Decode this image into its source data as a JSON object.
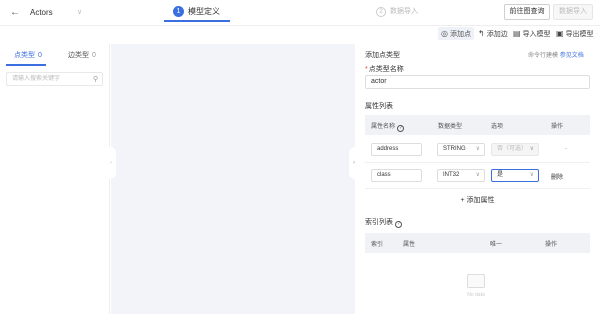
{
  "header": {
    "back_icon": "arrow-left-icon",
    "title": "Actors",
    "steps": [
      {
        "num": "1",
        "label": "模型定义"
      },
      {
        "num": "2",
        "label": "数据导入"
      }
    ],
    "query_button": "前往图查询",
    "import_button": "数据导入"
  },
  "toolbar": {
    "add_node": "添加点",
    "add_edge": "添加边",
    "import_model": "导入模型",
    "export_model": "导出模型"
  },
  "left": {
    "tabs": [
      {
        "label": "点类型",
        "count": "0"
      },
      {
        "label": "边类型",
        "count": "0"
      }
    ],
    "search_placeholder": "请输入搜索关键字"
  },
  "right": {
    "title": "添加点类型",
    "cli_text": "命令行建模",
    "cli_link": "参见文档",
    "name_label": "点类型名称",
    "name_value": "actor",
    "props_label": "属性列表",
    "prop_headers": {
      "name": "属性名称",
      "type": "数据类型",
      "option": "选项",
      "action": "操作"
    },
    "props": [
      {
        "name": "address",
        "type": "STRING",
        "option": "否（可选）",
        "action": "-"
      },
      {
        "name": "class",
        "type": "INT32",
        "option": "是",
        "action": "删除"
      }
    ],
    "add_prop": "添加属性",
    "index_label": "索引列表",
    "index_headers": {
      "index": "索引",
      "prop": "属性",
      "unique": "唯一",
      "action": "操作"
    },
    "empty_text": "No data"
  },
  "colors": {
    "accent": "#3b6fe0",
    "canvas": "#f3f4f9"
  }
}
